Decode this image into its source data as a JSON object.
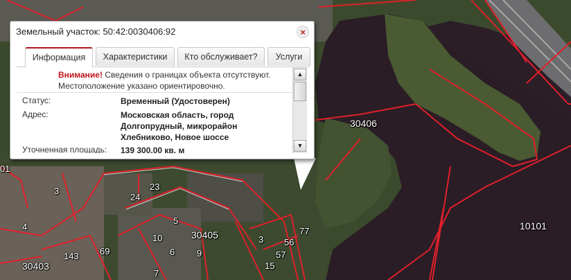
{
  "popup": {
    "title": "Земельный участок: 50:42:0030406:92",
    "close_label": "×",
    "tabs": [
      {
        "label": "Информация",
        "active": true
      },
      {
        "label": "Характеристики",
        "active": false
      },
      {
        "label": "Кто обслуживает?",
        "active": false
      },
      {
        "label": "Услуги",
        "active": false
      }
    ],
    "notice": {
      "warning": "Внимание!",
      "text": " Сведения о границах объекта отсутствуют. Местоположение указано ориентировочно."
    },
    "fields": [
      {
        "key": "Статус:",
        "value": "Временный (Удостоверен)"
      },
      {
        "key": "Адрес:",
        "value": "Московская область, город Долгопрудный, микрорайон Хлебниково, Новое шоссе"
      },
      {
        "key": "Уточненная площадь:",
        "value": "139 300.00 кв. м"
      }
    ],
    "scroll_up": "▲",
    "scroll_down": "▼"
  },
  "map": {
    "labels": [
      "30406",
      "30405",
      "30403",
      "10101",
      "3",
      "4",
      "5",
      "6",
      "7",
      "9",
      "10",
      "24",
      "23",
      "77",
      "56",
      "57",
      "15",
      "143",
      "69",
      "01",
      "3"
    ],
    "boundary_color": "#e0202a"
  }
}
